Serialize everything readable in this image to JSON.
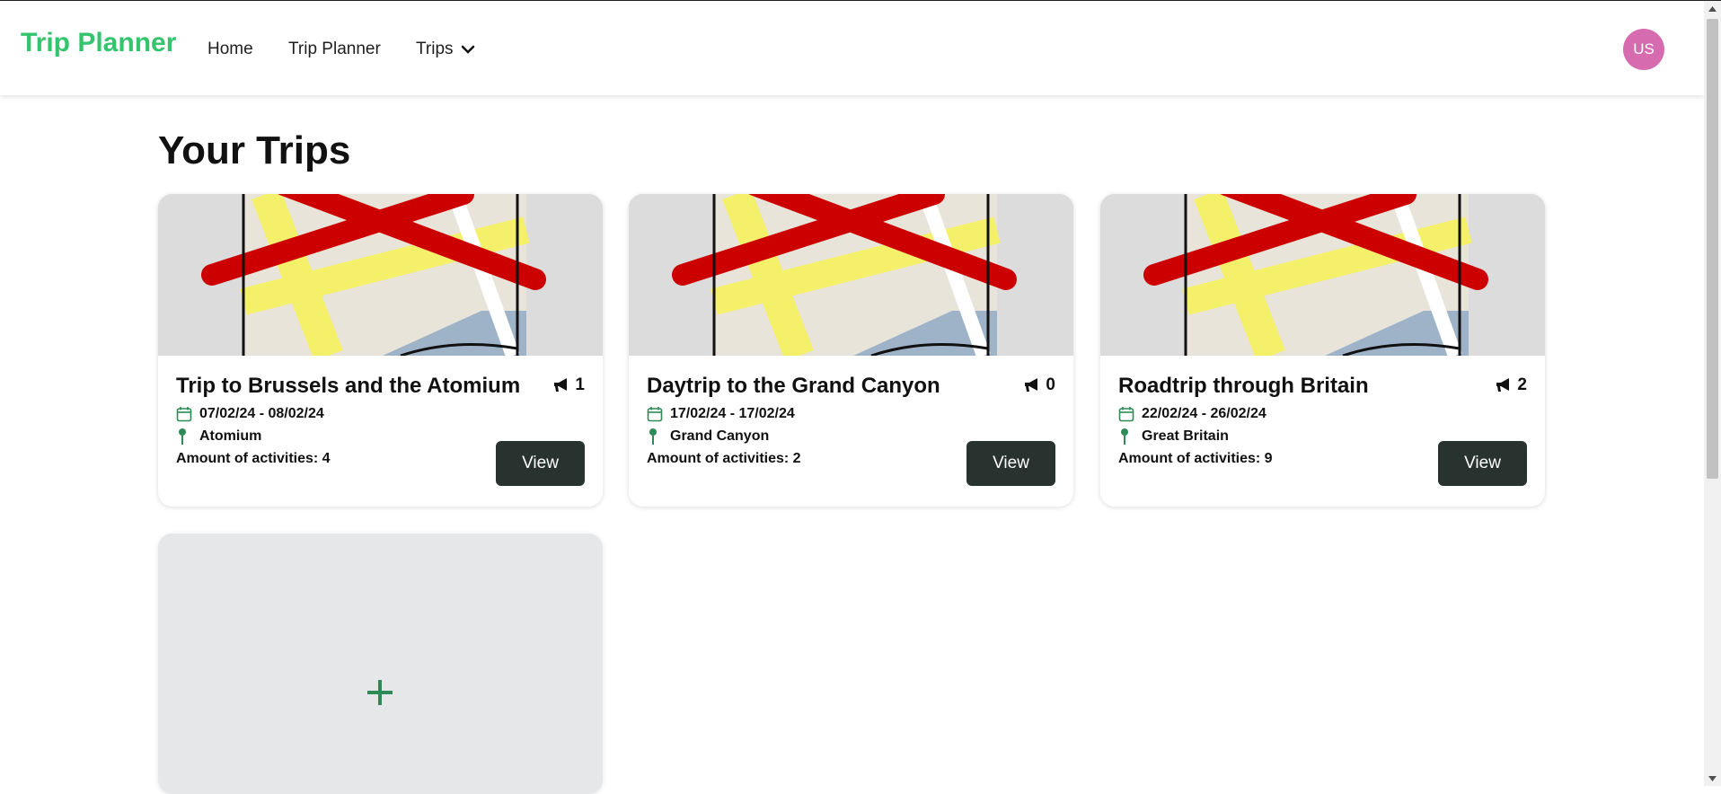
{
  "nav": {
    "brand": "Trip Planner",
    "links": [
      "Home",
      "Trip Planner"
    ],
    "trips_label": "Trips",
    "avatar_initials": "US"
  },
  "page": {
    "title": "Your Trips"
  },
  "trips": [
    {
      "title": "Trip to Brussels and the Atomium",
      "announcements": "1",
      "dates": "07/02/24 - 08/02/24",
      "location": "Atomium",
      "activities": "Amount of activities: 4",
      "button": "View"
    },
    {
      "title": "Daytrip to the Grand Canyon",
      "announcements": "0",
      "dates": "17/02/24 - 17/02/24",
      "location": "Grand Canyon",
      "activities": "Amount of activities: 2",
      "button": "View"
    },
    {
      "title": "Roadtrip through Britain",
      "announcements": "2",
      "dates": "22/02/24 - 26/02/24",
      "location": "Great Britain",
      "activities": "Amount of activities: 9",
      "button": "View"
    }
  ],
  "icons": {
    "brand_color": "#35c46e",
    "accent": "#2e8b57",
    "button_bg": "#283330",
    "avatar_bg": "#d66bb0",
    "trip_image": "broken-map-image",
    "add": "plus-icon"
  }
}
